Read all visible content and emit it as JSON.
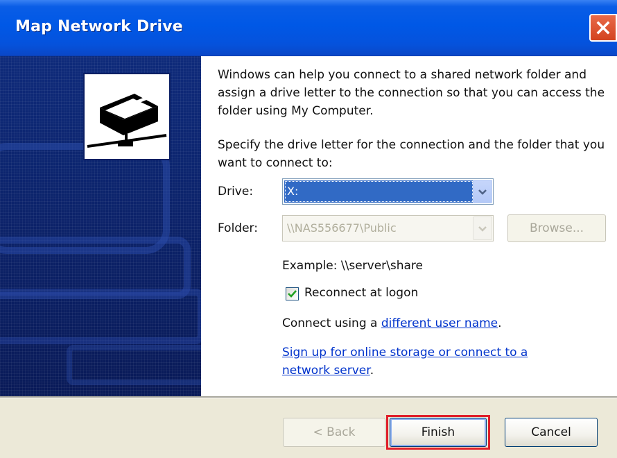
{
  "window": {
    "title": "Map Network Drive"
  },
  "intro": {
    "paragraph1": "Windows can help you connect to a shared network folder and assign a drive letter to the connection so that you can access the folder using My Computer.",
    "paragraph2": "Specify the drive letter for the connection and the folder that you want to connect to:"
  },
  "form": {
    "drive_label": "Drive:",
    "drive_value": "X:",
    "folder_label": "Folder:",
    "folder_value": "\\\\NAS556677\\Public",
    "browse_label": "Browse...",
    "example_text": "Example: \\\\server\\share",
    "reconnect_label": "Reconnect at logon",
    "reconnect_checked": true
  },
  "links": {
    "connect_prefix": "Connect using a ",
    "different_user": "different user name",
    "connect_suffix": ".",
    "signup_link_line1": "Sign up for online storage or connect to a",
    "signup_link_line2": "network server",
    "signup_suffix": "."
  },
  "buttons": {
    "back": "< Back",
    "finish": "Finish",
    "cancel": "Cancel"
  },
  "colors": {
    "titlebar": "#0058e6",
    "side_panel": "#0b1f64",
    "selection": "#316ac5",
    "highlight_border": "#e0202a",
    "link": "#0033cc"
  },
  "icons": [
    "close-icon",
    "network-drive-icon",
    "dropdown-arrow-icon",
    "checkmark-icon"
  ]
}
